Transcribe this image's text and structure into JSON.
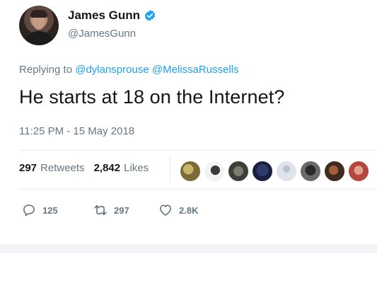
{
  "tweet": {
    "author": {
      "display_name": "James Gunn",
      "handle": "@JamesGunn",
      "verified": true
    },
    "replying_to": {
      "prefix": "Replying to",
      "mentions": [
        "@dylansprouse",
        "@MelissaRussells"
      ]
    },
    "text": "He starts at 18 on the Internet?",
    "timestamp": "11:25 PM - 15 May 2018",
    "stats": {
      "retweets_count": "297",
      "retweets_label": "Retweets",
      "likes_count": "2,842",
      "likes_label": "Likes"
    },
    "liker_avatars": [
      "liker-avatar-1",
      "liker-avatar-2",
      "liker-avatar-3",
      "liker-avatar-4",
      "liker-avatar-5",
      "liker-avatar-6",
      "liker-avatar-7",
      "liker-avatar-8",
      "liker-avatar-9"
    ],
    "actions": {
      "reply_count": "125",
      "retweet_count": "297",
      "like_count": "2.8K"
    }
  },
  "colors": {
    "link": "#1da1f2",
    "secondary_text": "#657786",
    "primary_text": "#14171a",
    "divider": "#e6ecf0",
    "verified_badge": "#1da1f2"
  }
}
